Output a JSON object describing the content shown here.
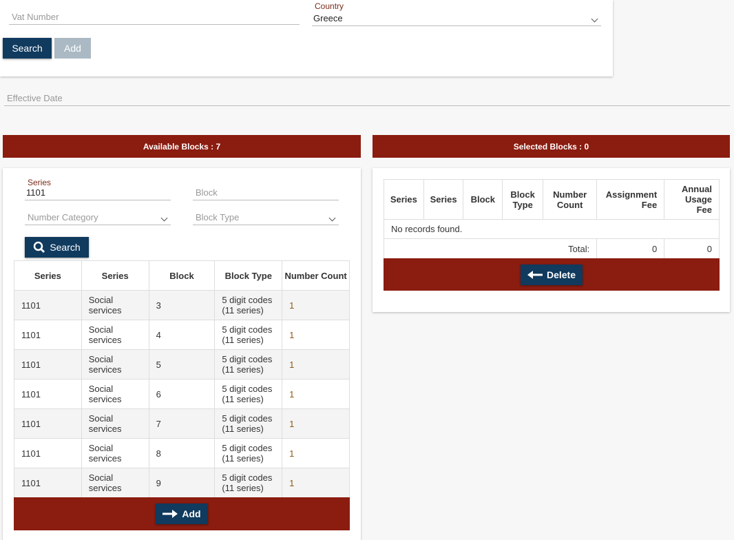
{
  "top": {
    "vat_placeholder": "Vat Number",
    "country_label": "Country",
    "country_value": "Greece",
    "search_label": "Search",
    "add_label": "Add"
  },
  "effective_date_placeholder": "Effective Date",
  "available": {
    "title": "Available Blocks : 7",
    "series_label": "Series",
    "series_value": "1101",
    "block_placeholder": "Block",
    "number_category_placeholder": "Number Category",
    "block_type_placeholder": "Block Type",
    "search_label": "Search",
    "columns": [
      "Series",
      "Series",
      "Block",
      "Block Type",
      "Number Count"
    ],
    "rows": [
      [
        "1101",
        "Social services",
        "3",
        "5 digit codes (11 series)",
        "1"
      ],
      [
        "1101",
        "Social services",
        "4",
        "5 digit codes (11 series)",
        "1"
      ],
      [
        "1101",
        "Social services",
        "5",
        "5 digit codes (11 series)",
        "1"
      ],
      [
        "1101",
        "Social services",
        "6",
        "5 digit codes (11 series)",
        "1"
      ],
      [
        "1101",
        "Social services",
        "7",
        "5 digit codes (11 series)",
        "1"
      ],
      [
        "1101",
        "Social services",
        "8",
        "5 digit codes (11 series)",
        "1"
      ],
      [
        "1101",
        "Social services",
        "9",
        "5 digit codes (11 series)",
        "1"
      ]
    ],
    "add_label": "Add"
  },
  "selected": {
    "title": "Selected Blocks : 0",
    "columns": [
      "Series",
      "Series",
      "Block",
      "Block Type",
      "Number Count",
      "Assignment Fee",
      "Annual Usage Fee"
    ],
    "empty": "No records found.",
    "total_label": "Total:",
    "total_assignment": "0",
    "total_annual": "0",
    "delete_label": "Delete"
  },
  "colors": {
    "primary": "#103a5e",
    "header_bar": "#8b1c10"
  }
}
